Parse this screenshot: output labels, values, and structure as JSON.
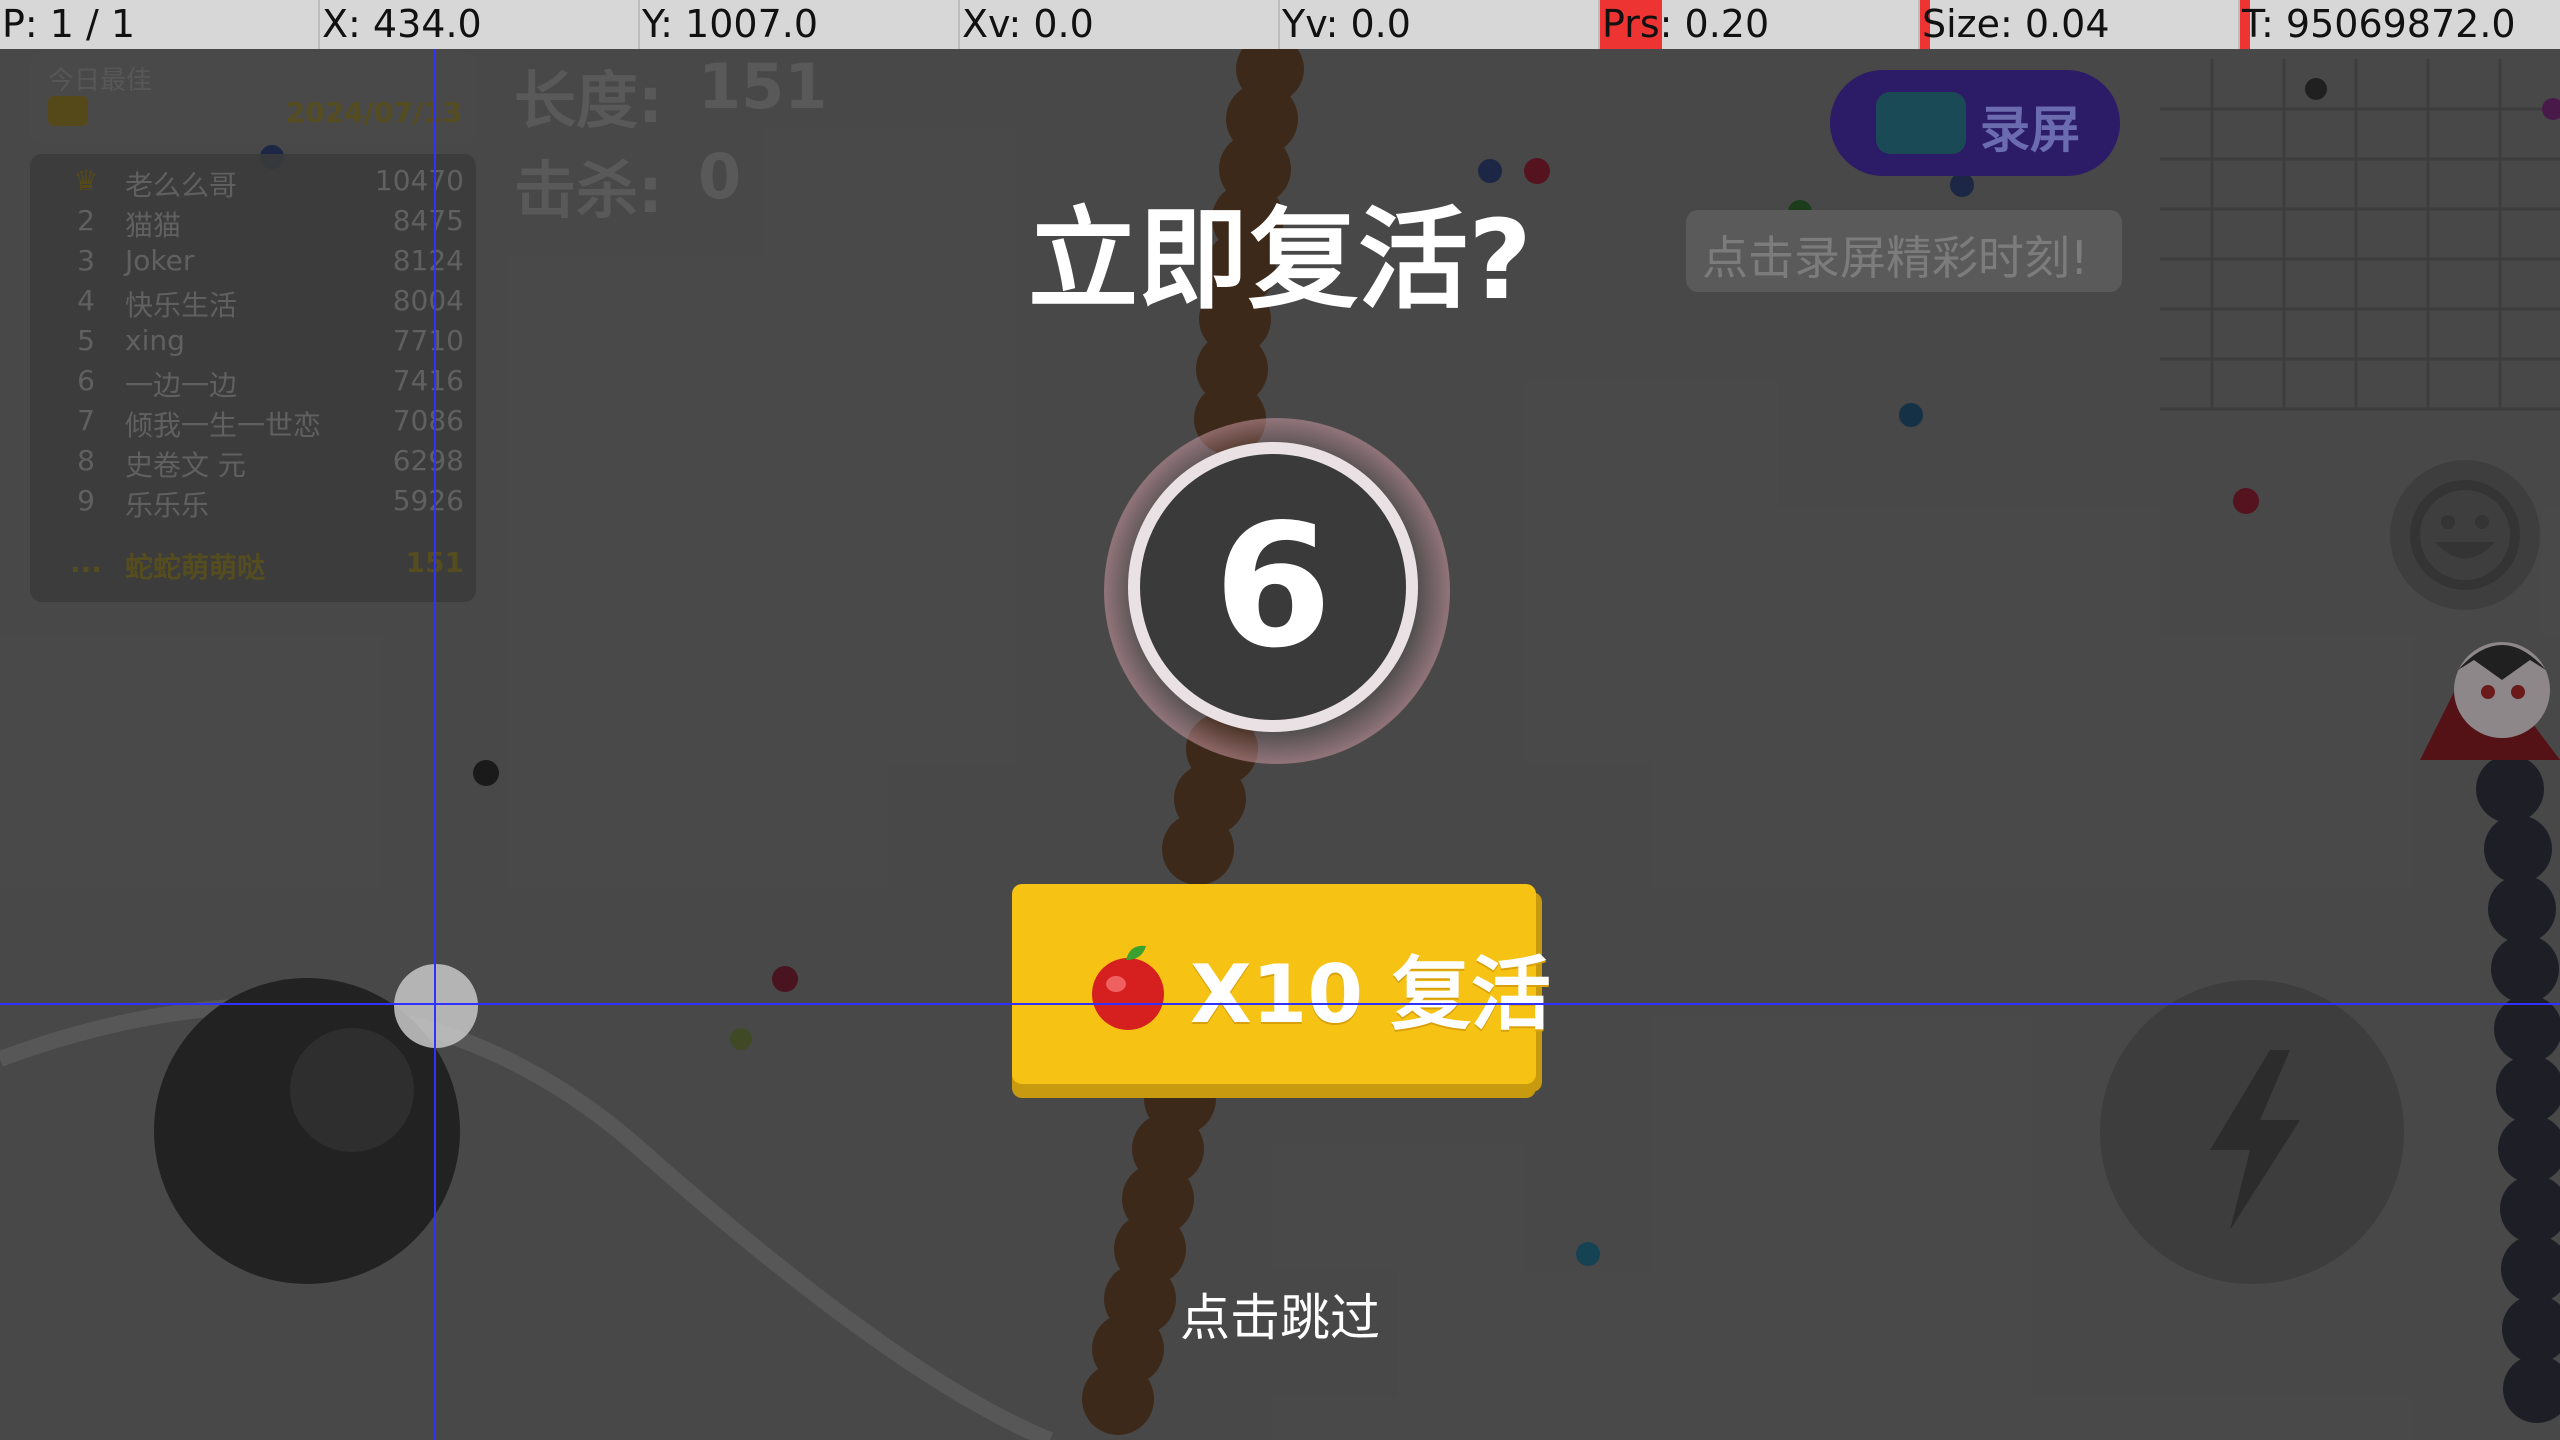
{
  "debug_bar": {
    "pointer": "P: 1 / 1",
    "x": "X: 434.0",
    "y": "Y: 1007.0",
    "xv": "Xv: 0.0",
    "yv": "Yv: 0.0",
    "prs": "Prs: 0.20",
    "size": "Size: 0.04",
    "t": "T: 95069872.0"
  },
  "leaderboard": {
    "header_title": "今日最佳",
    "header_date": "2024/07/13",
    "rows": [
      {
        "rank": "",
        "name": "老么么哥",
        "score": "10470"
      },
      {
        "rank": "2",
        "name": "猫猫",
        "score": "8475"
      },
      {
        "rank": "3",
        "name": "Joker",
        "score": "8124"
      },
      {
        "rank": "4",
        "name": "快乐生活",
        "score": "8004"
      },
      {
        "rank": "5",
        "name": "xing",
        "score": "7710"
      },
      {
        "rank": "6",
        "name": "一边一边",
        "score": "7416"
      },
      {
        "rank": "7",
        "name": "倾我一生一世恋",
        "score": "7086"
      },
      {
        "rank": "8",
        "name": "史卷文 元",
        "score": "6298"
      },
      {
        "rank": "9",
        "name": "乐乐乐",
        "score": "5926"
      }
    ],
    "self_row": {
      "rank": "...",
      "name": "蛇蛇萌萌哒",
      "score": "151"
    }
  },
  "hud": {
    "length_label": "长度:",
    "length_value": "151",
    "kills_label": "击杀:",
    "kills_value": "0"
  },
  "record": {
    "button_label": "录屏",
    "tooltip": "点击录屏精彩时刻!"
  },
  "revive_dialog": {
    "title": "立即复活?",
    "countdown": "6",
    "revive_button_label": "X10 复活",
    "skip_label": "点击跳过"
  },
  "colors": {
    "button_yellow": "#f6c314",
    "record_purple": "#2c1b67",
    "crosshair_blue": "#3030ff"
  }
}
